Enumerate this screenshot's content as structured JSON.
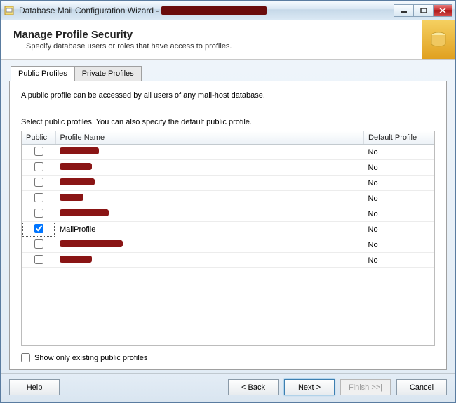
{
  "window": {
    "title": "Database Mail Configuration Wizard -"
  },
  "header": {
    "heading": "Manage Profile Security",
    "subtitle": "Specify database users or roles that have access to profiles."
  },
  "tabs": {
    "public": "Public Profiles",
    "private": "Private Profiles"
  },
  "panel": {
    "description": "A public profile can be accessed by all users of any mail-host database.",
    "instruction": "Select public profiles. You can also specify the default public profile.",
    "columns": {
      "public": "Public",
      "profile_name": "Profile Name",
      "default_profile": "Default Profile"
    },
    "rows": [
      {
        "checked": false,
        "name_redacted": true,
        "redact_width": 56,
        "default": "No"
      },
      {
        "checked": false,
        "name_redacted": true,
        "redact_width": 46,
        "default": "No"
      },
      {
        "checked": false,
        "name_redacted": true,
        "redact_width": 50,
        "default": "No"
      },
      {
        "checked": false,
        "name_redacted": true,
        "redact_width": 34,
        "default": "No"
      },
      {
        "checked": false,
        "name_redacted": true,
        "redact_width": 70,
        "default": "No"
      },
      {
        "checked": true,
        "name_redacted": false,
        "name": "MailProfile",
        "default": "No"
      },
      {
        "checked": false,
        "name_redacted": true,
        "redact_width": 90,
        "default": "No"
      },
      {
        "checked": false,
        "name_redacted": true,
        "redact_width": 46,
        "default": "No"
      }
    ],
    "show_only_label": "Show only existing public profiles",
    "show_only_checked": false
  },
  "buttons": {
    "help": "Help",
    "back": "< Back",
    "next": "Next >",
    "finish": "Finish >>|",
    "cancel": "Cancel"
  }
}
